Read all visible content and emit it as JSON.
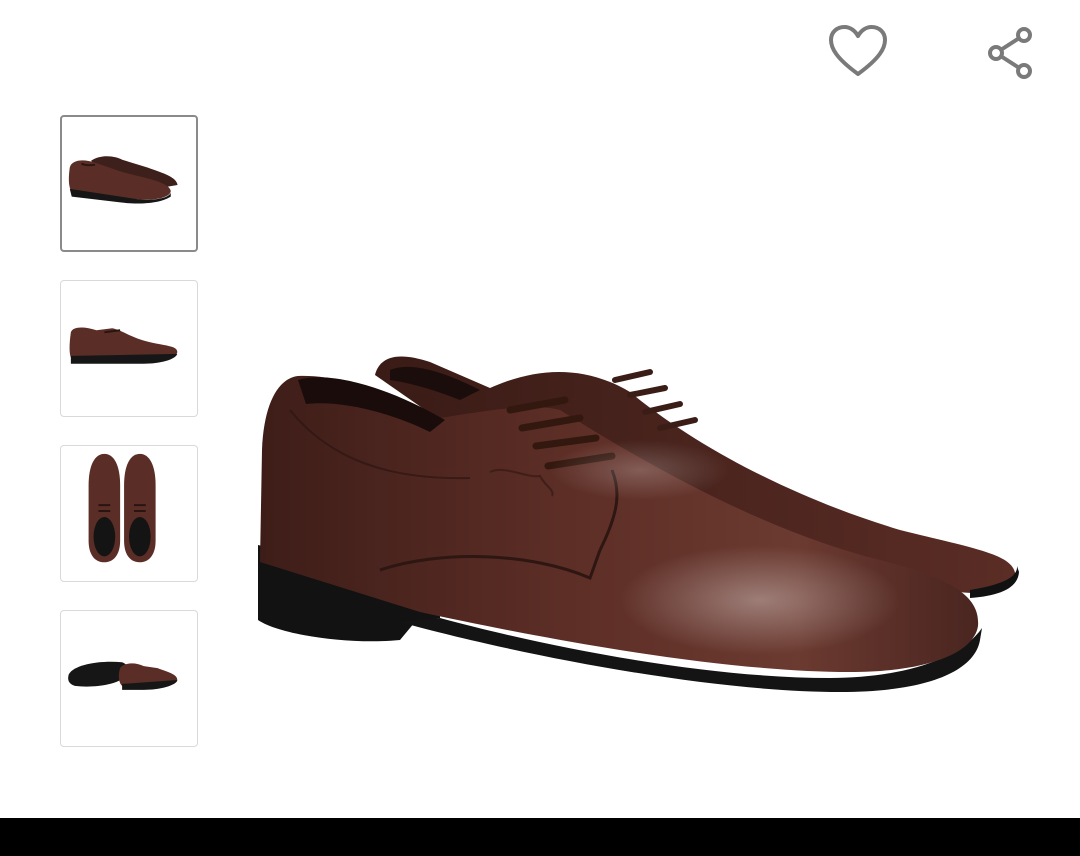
{
  "actions": {
    "favorite_icon": "heart-outline-icon",
    "share_icon": "share-icon",
    "icon_color": "#7a7a7a"
  },
  "gallery": {
    "selected_index": 0,
    "thumbnails": [
      {
        "view": "pair-side-angle"
      },
      {
        "view": "single-side"
      },
      {
        "view": "pair-top-down"
      },
      {
        "view": "pair-sole-and-side"
      }
    ],
    "product_color": "#4a2520",
    "sole_color": "#161616"
  },
  "system": {
    "nav_bar_color": "#000000"
  }
}
